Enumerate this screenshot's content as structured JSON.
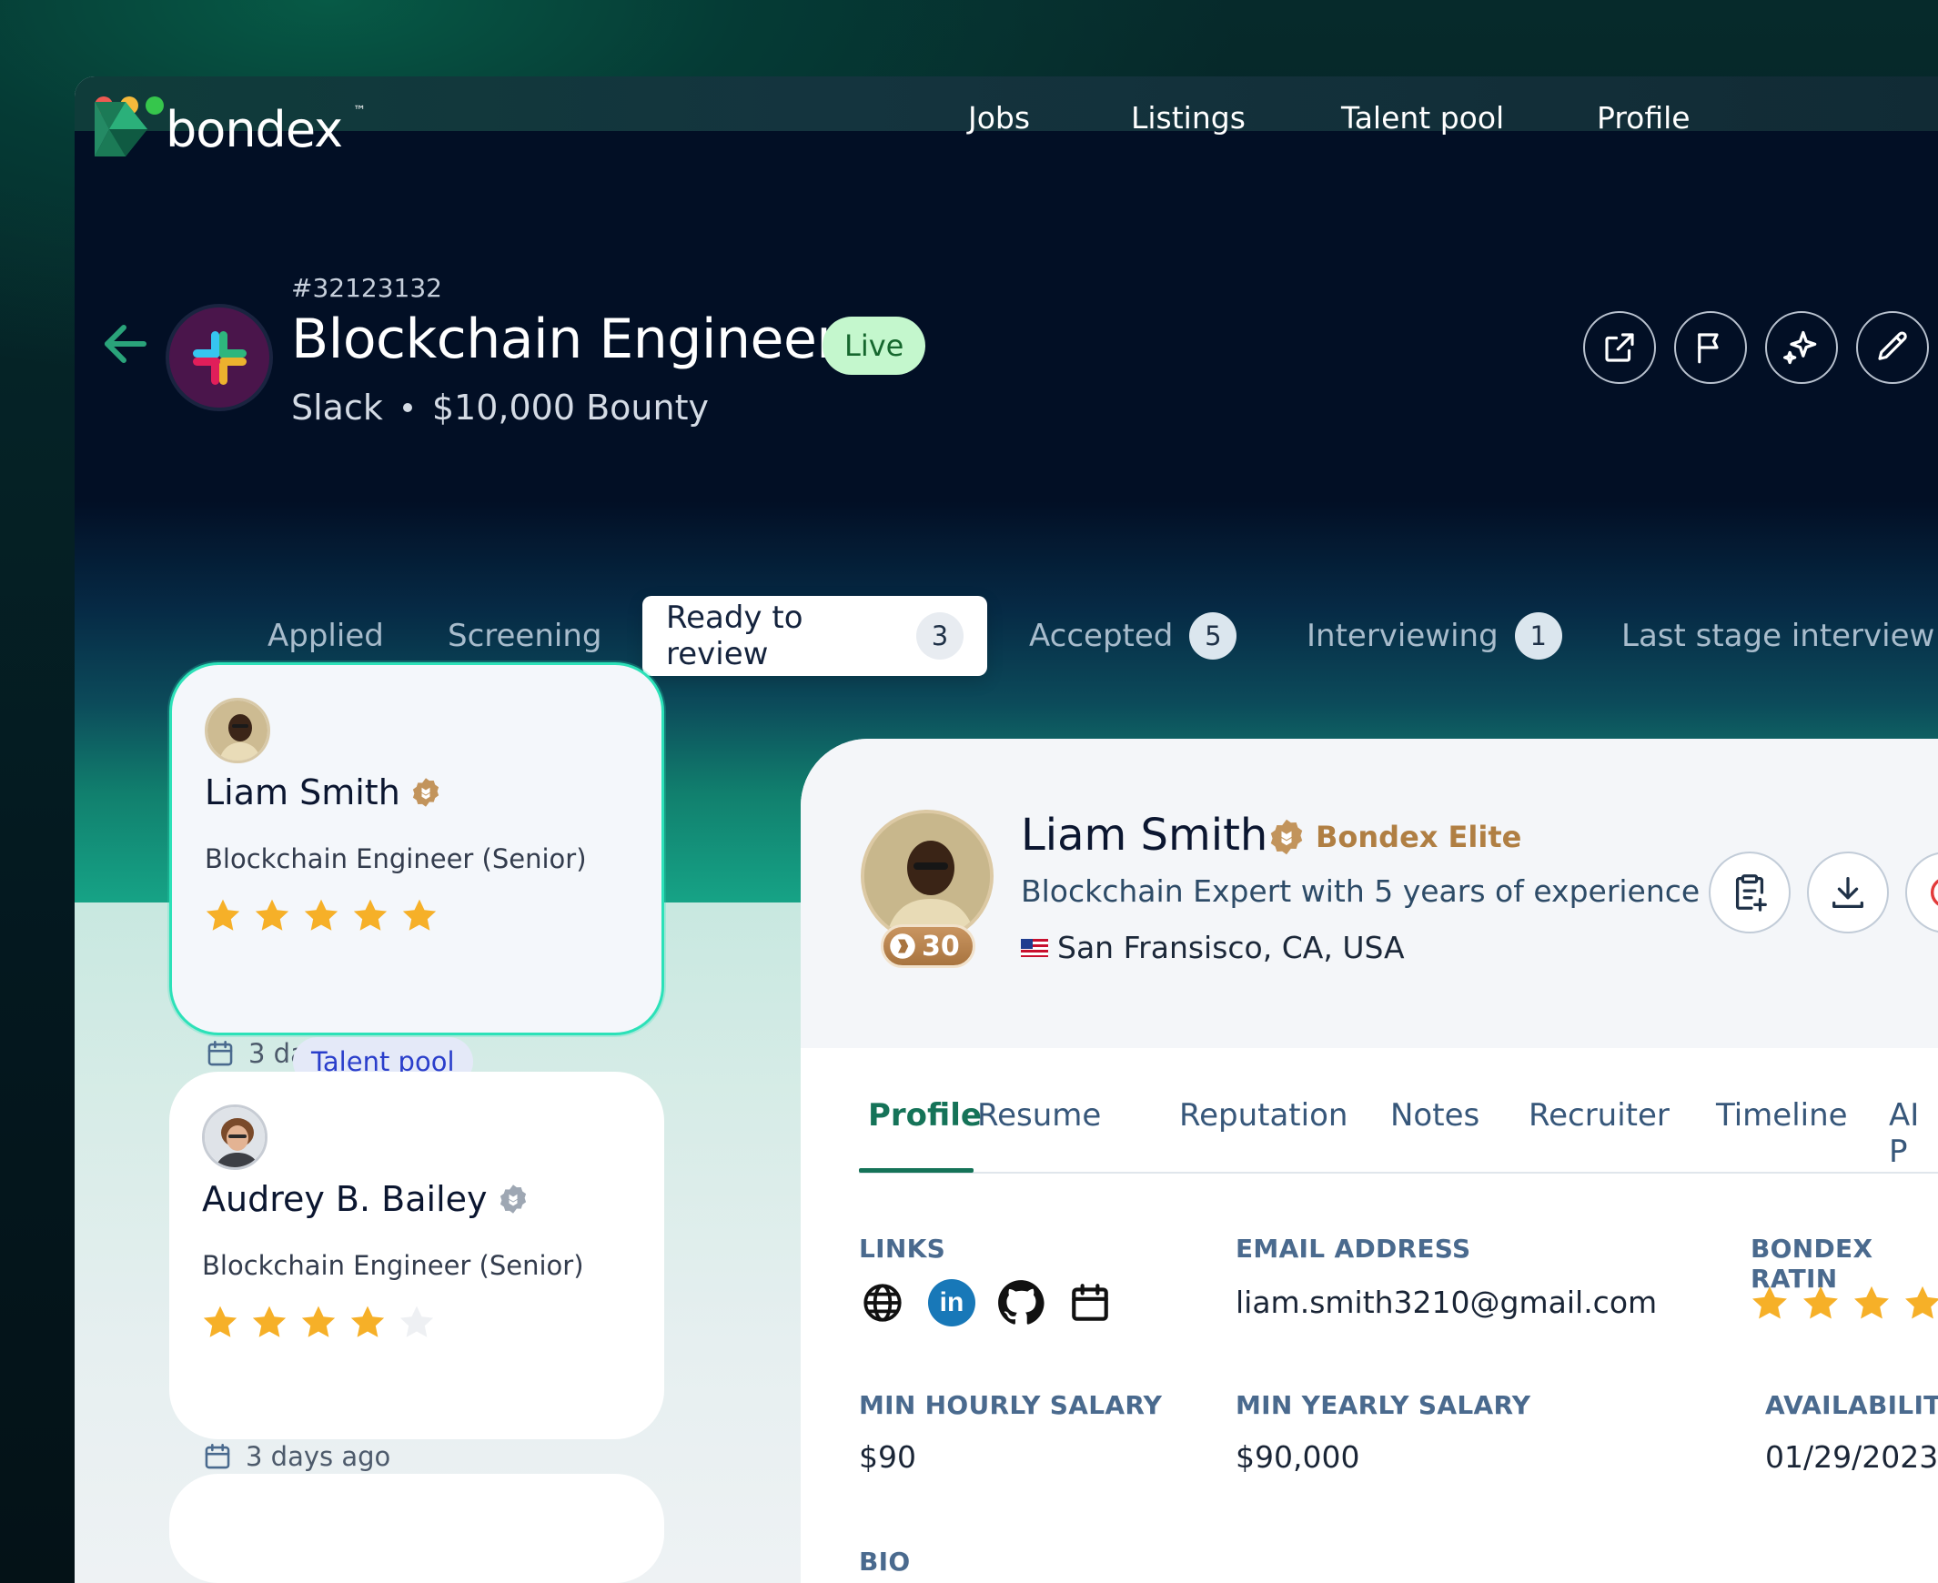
{
  "nav": {
    "brand": "bondex",
    "brand_tm": "™",
    "items": [
      "Jobs",
      "Listings",
      "Talent pool",
      "Profile"
    ]
  },
  "job": {
    "id": "#32123132",
    "title": "Blockchain Engineer",
    "status": "Live",
    "company": "Slack",
    "bounty": "$10,000 Bounty"
  },
  "header_actions": [
    "external-link-icon",
    "flag-icon",
    "sparkles-icon",
    "pencil-icon"
  ],
  "stages": [
    {
      "label": "Applied",
      "count": ""
    },
    {
      "label": "Screening",
      "count": ""
    },
    {
      "label": "Ready to review",
      "count": "3"
    },
    {
      "label": "Accepted",
      "count": "5"
    },
    {
      "label": "Interviewing",
      "count": "1"
    },
    {
      "label": "Last stage interview",
      "count": ""
    }
  ],
  "candidates": [
    {
      "name": "Liam Smith",
      "role": "Blockchain Engineer (Senior)",
      "rating": 5,
      "date": "3 days ago",
      "tag": "Talent pool"
    },
    {
      "name": "Audrey B. Bailey",
      "role": "Blockchain Engineer (Senior)",
      "rating": 4,
      "date": "3 days ago",
      "tag": ""
    }
  ],
  "detail": {
    "name": "Liam Smith",
    "tier": "Bondex Elite",
    "score": "30",
    "headline": "Blockchain Expert with 5 years of experience",
    "location": "San Fransisco, CA, USA",
    "tabs": [
      "Profile",
      "Resume",
      "Reputation",
      "Notes",
      "Recruiter",
      "Timeline",
      "AI P"
    ],
    "fields": {
      "links_label": "LINKS",
      "email_label": "EMAIL ADDRESS",
      "email": "liam.smith3210@gmail.com",
      "rating_label": "BONDEX RATIN",
      "min_hourly_label": "MIN HOURLY SALARY",
      "min_hourly": "$90",
      "min_yearly_label": "MIN YEARLY SALARY",
      "min_yearly": "$90,000",
      "availability_label": "AVAILABILITY",
      "availability": "01/29/2023",
      "bio_label": "BIO"
    },
    "links": [
      "globe-icon",
      "linkedin-icon",
      "github-icon",
      "calendar-icon"
    ],
    "linkedin_text": "in"
  },
  "colors": {
    "accent_green": "#157358",
    "live_bg": "#c4f7cd",
    "star": "#f6b028",
    "elite_gold": "#b07f43",
    "selected_border": "#2ce1b8"
  }
}
